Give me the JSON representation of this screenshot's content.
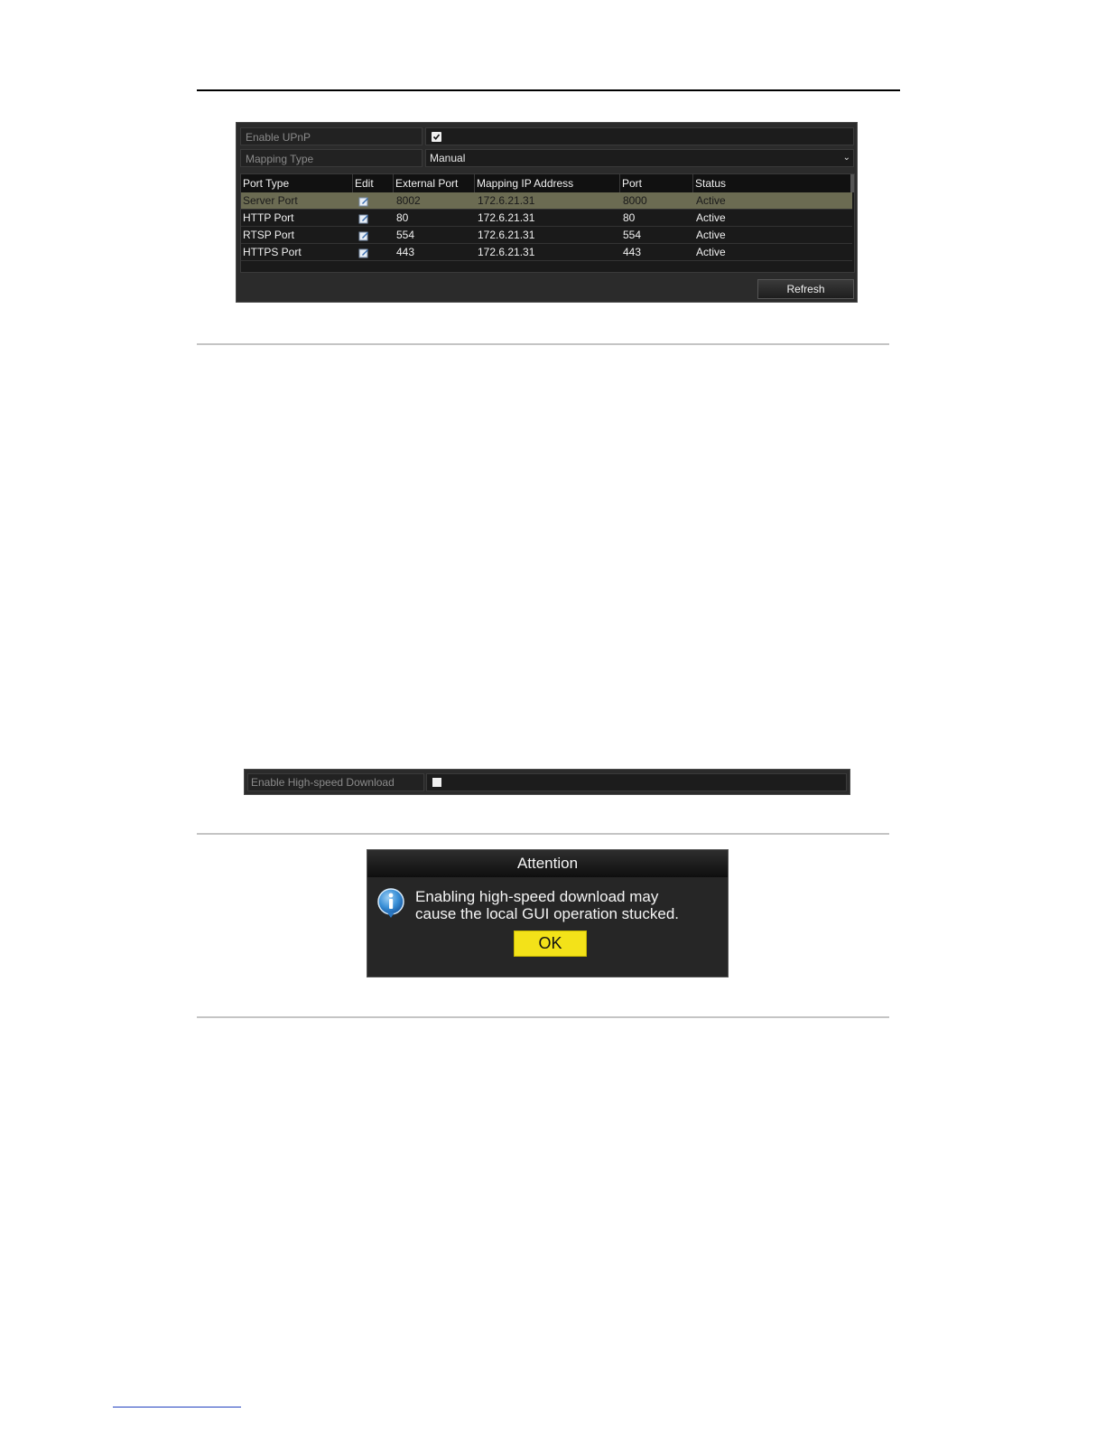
{
  "upnp": {
    "enable_label": "Enable UPnP",
    "enable_checked": true,
    "mapping_type_label": "Mapping Type",
    "mapping_type_value": "Manual",
    "columns": [
      "Port Type",
      "Edit",
      "External Port",
      "Mapping IP Address",
      "Port",
      "Status"
    ],
    "rows": [
      {
        "port_type": "Server Port",
        "external_port": "8002",
        "ip": "172.6.21.31",
        "port": "8000",
        "status": "Active"
      },
      {
        "port_type": "HTTP Port",
        "external_port": "80",
        "ip": "172.6.21.31",
        "port": "80",
        "status": "Active"
      },
      {
        "port_type": "RTSP Port",
        "external_port": "554",
        "ip": "172.6.21.31",
        "port": "554",
        "status": "Active"
      },
      {
        "port_type": "HTTPS Port",
        "external_port": "443",
        "ip": "172.6.21.31",
        "port": "443",
        "status": "Active"
      }
    ],
    "refresh_label": "Refresh"
  },
  "high_speed": {
    "label": "Enable High-speed Download",
    "checked": false
  },
  "dialog": {
    "title": "Attention",
    "message_line1": "Enabling high-speed download may",
    "message_line2": "cause the local GUI operation stucked.",
    "ok_label": "OK"
  },
  "colors": {
    "panel_bg": "#2b2b2b",
    "selected_row": "#6b6b52",
    "ok_button": "#f3e219"
  }
}
